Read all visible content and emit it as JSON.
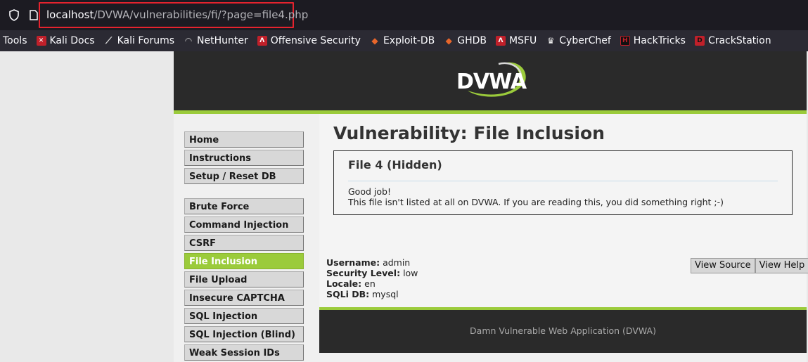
{
  "browser": {
    "url_host": "localhost",
    "url_rest": "/DVWA/vulnerabilities/fi/?page=file4.php",
    "highlight_color": "#e5232e",
    "bookmarks": [
      {
        "label": "Tools",
        "icon": "none"
      },
      {
        "label": "Kali Docs",
        "icon": "kali-docs-icon"
      },
      {
        "label": "Kali Forums",
        "icon": "kali-dragon-icon"
      },
      {
        "label": "NetHunter",
        "icon": "nethunter-icon"
      },
      {
        "label": "Offensive Security",
        "icon": "offsec-icon"
      },
      {
        "label": "Exploit-DB",
        "icon": "exploit-db-icon"
      },
      {
        "label": "GHDB",
        "icon": "ghdb-icon"
      },
      {
        "label": "MSFU",
        "icon": "msfu-icon"
      },
      {
        "label": "CyberChef",
        "icon": "cyberchef-icon"
      },
      {
        "label": "HackTricks",
        "icon": "hacktricks-icon"
      },
      {
        "label": "CrackStation",
        "icon": "crackstation-icon"
      }
    ]
  },
  "dvwa": {
    "accent": "#9bcb3b",
    "logo_text": "DVWA",
    "menu_group_1": [
      "Home",
      "Instructions",
      "Setup / Reset DB"
    ],
    "menu_group_2": [
      "Brute Force",
      "Command Injection",
      "CSRF",
      "File Inclusion",
      "File Upload",
      "Insecure CAPTCHA",
      "SQL Injection",
      "SQL Injection (Blind)",
      "Weak Session IDs"
    ],
    "active_item": "File Inclusion",
    "page_title": "Vulnerability: File Inclusion",
    "box": {
      "title": "File 4 (Hidden)",
      "line1": "Good job!",
      "line2": "This file isn't listed at all on DVWA. If you are reading this, you did something right ;-)"
    },
    "info": {
      "username_label": "Username:",
      "username": "admin",
      "security_label": "Security Level:",
      "security": "low",
      "locale_label": "Locale:",
      "locale": "en",
      "sqli_label": "SQLi DB:",
      "sqli": "mysql"
    },
    "buttons": {
      "view_source": "View Source",
      "view_help": "View Help"
    },
    "footer": "Damn Vulnerable Web Application (DVWA)"
  }
}
